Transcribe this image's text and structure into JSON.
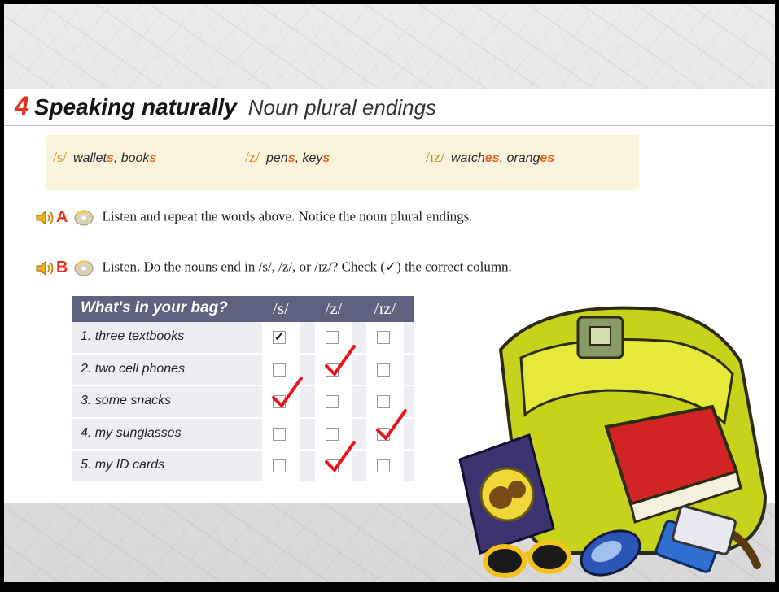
{
  "section": {
    "number": "4",
    "title": "Speaking naturally",
    "subtitle": "Noun plural endings"
  },
  "examples": [
    {
      "phoneme": "/s/",
      "words": [
        {
          "stem": "wallet",
          "ending": "s",
          "sep": ", "
        },
        {
          "stem": "book",
          "ending": "s",
          "sep": ""
        }
      ]
    },
    {
      "phoneme": "/z/",
      "words": [
        {
          "stem": "pen",
          "ending": "s",
          "sep": ", "
        },
        {
          "stem": "key",
          "ending": "s",
          "sep": ""
        }
      ]
    },
    {
      "phoneme": "/ɪz/",
      "words": [
        {
          "stem": "watch",
          "ending": "es",
          "sep": ", "
        },
        {
          "stem": "orang",
          "ending": "es",
          "sep": ""
        }
      ]
    }
  ],
  "steps": [
    {
      "letter": "A",
      "text": "Listen and repeat the words above. Notice the noun plural endings."
    },
    {
      "letter": "B",
      "text": "Listen. Do the nouns end in /s/, /z/, or /ɪz/? Check (✓) the correct column."
    }
  ],
  "table": {
    "header": "What's in your bag?",
    "columns": [
      "/s/",
      "/z/",
      "/ɪz/"
    ],
    "rows": [
      {
        "label": "1. three textbooks",
        "printed_check": 0,
        "handwritten_check": null
      },
      {
        "label": "2. two cell phones",
        "printed_check": null,
        "handwritten_check": 1
      },
      {
        "label": "3. some snacks",
        "printed_check": null,
        "handwritten_check": 0
      },
      {
        "label": "4. my sunglasses",
        "printed_check": null,
        "handwritten_check": 2
      },
      {
        "label": "5. my ID cards",
        "printed_check": null,
        "handwritten_check": 1
      }
    ]
  },
  "colors": {
    "accent_red": "#e33220",
    "header_bg": "#5e627e",
    "ending_orange": "#e6642a",
    "phoneme_gold": "#c08a1d",
    "check_red": "#e8141e"
  },
  "illustration": "school-bag-with-book-sunglasses-phone-cards-snack"
}
